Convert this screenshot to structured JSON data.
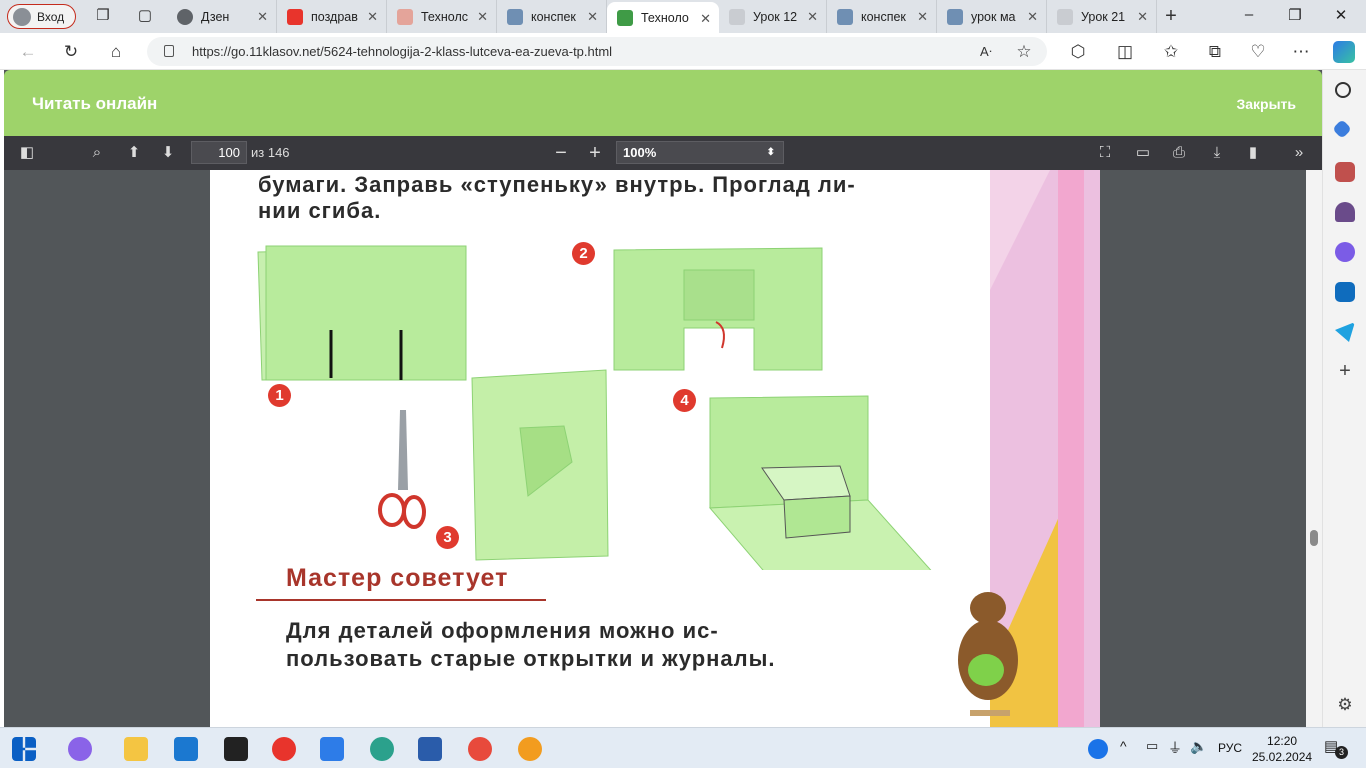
{
  "browser": {
    "profile_label": "Вход",
    "tabs": [
      {
        "label": "Дзен",
        "color": "#5f6368"
      },
      {
        "label": "поздрав",
        "color": "#e8342c"
      },
      {
        "label": "Технолс",
        "color": "#e4a49a"
      },
      {
        "label": "конспек",
        "color": "#6f8fb3"
      },
      {
        "label": "Техноло",
        "color": "#3f9b46",
        "active": true
      },
      {
        "label": "Урок 12",
        "color": "#c9ccd1"
      },
      {
        "label": "конспек",
        "color": "#6f8fb3"
      },
      {
        "label": "урок ма",
        "color": "#6f8fb3"
      },
      {
        "label": "Урок 21",
        "color": "#c9ccd1"
      }
    ],
    "url": "https://go.11klasov.net/5624-tehnologija-2-klass-lutceva-ea-zueva-tp.html",
    "address_text": "https://go.11klasov.net/5624-tehnologija-2-klass-lutceva-ea-zueva-tp.html"
  },
  "reader": {
    "title": "Читать онлайн",
    "close_label": "Закрыть"
  },
  "pdf_toolbar": {
    "page_number": "100",
    "page_total": "из 146",
    "zoom": "100%"
  },
  "page": {
    "line1": "бумаги. Заправь «ступеньку» внутрь. Проглад ли-",
    "line2": "нии сгиба.",
    "steps": [
      "1",
      "2",
      "3",
      "4"
    ],
    "master_title": "Мастер советует",
    "advice_line1": "Для деталей оформления можно ис-",
    "advice_line2": "пользовать старые открытки и журналы."
  },
  "taskbar": {
    "time": "12:20",
    "date": "25.02.2024",
    "lang": "РУС",
    "notifications": "3"
  },
  "colors": {
    "accent_green": "#9ed36a",
    "paper_green": "#b8eb9c",
    "pdf_toolbar": "#38383d"
  }
}
